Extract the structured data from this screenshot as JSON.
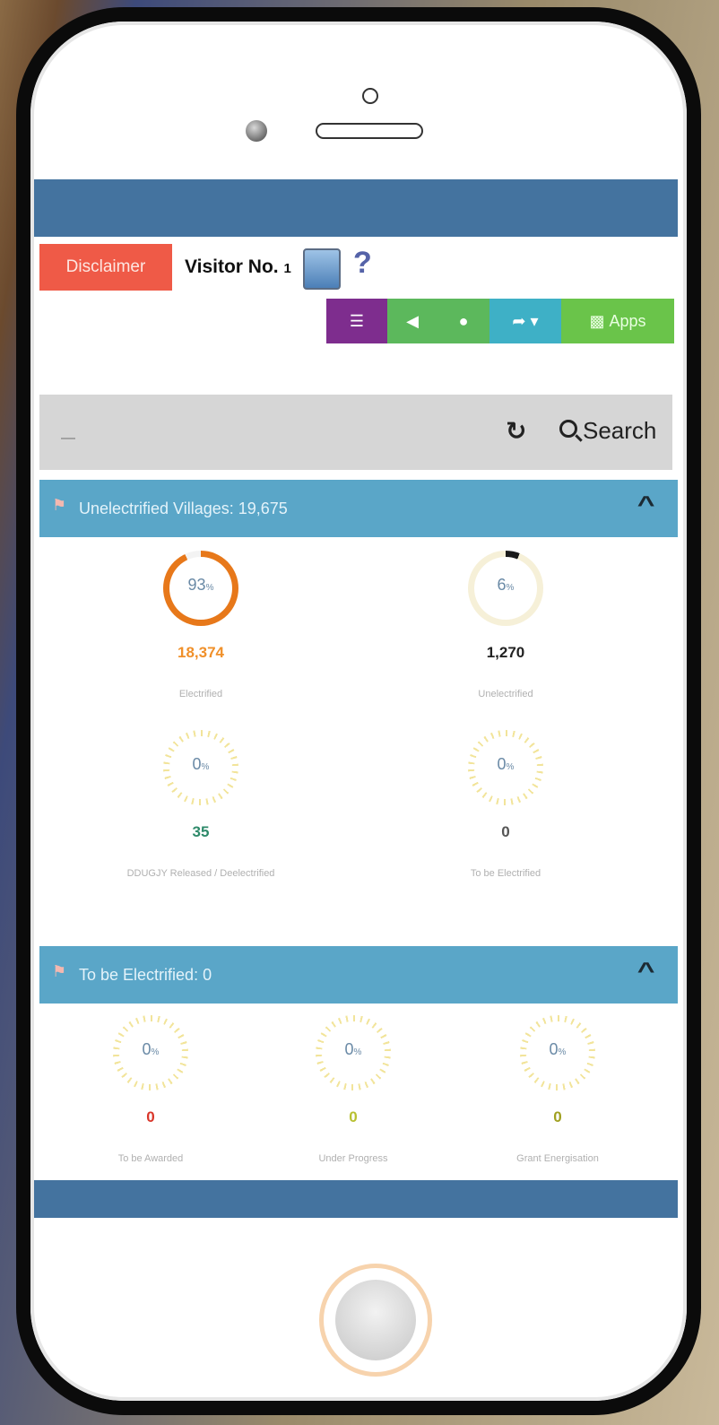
{
  "header": {
    "disclaimer_label": "Disclaimer",
    "visitor_label": "Visitor No.",
    "visitor_number": "1",
    "help_label": "?"
  },
  "toolbar": {
    "buttons": [
      {
        "icon": "list-icon",
        "label": "",
        "color": "#7e2d8e"
      },
      {
        "icon": "volume-icon",
        "label": "",
        "color": "#5cb85c"
      },
      {
        "icon": "microphone-icon",
        "label": "",
        "color": "#5cb85c"
      },
      {
        "icon": "share-icon",
        "label": "",
        "color": "#3eb0c6"
      },
      {
        "icon": "android-icon",
        "label": "Apps",
        "color": "#6ac44a"
      }
    ]
  },
  "search": {
    "placeholder": "—",
    "button_label": "Search",
    "refresh_icon": "refresh-icon"
  },
  "panel1": {
    "title": "Unelectrified Villages: 19,675",
    "stats": [
      {
        "percent": "93",
        "value": "18,374",
        "label": "Electrified",
        "value_color": "#f0902a",
        "ring_color": "#e7781a",
        "fill": 0.93
      },
      {
        "percent": "6",
        "value": "1,270",
        "label": "Unelectrified",
        "value_color": "#222222",
        "ring_color": "#1a1a1a",
        "fill": 0.06
      },
      {
        "percent": "0",
        "value": "35",
        "label": "DDUGJY Released / Deelectrified",
        "value_color": "#2e8a6a",
        "ring_color": "#e6c94a",
        "fill": 0.0
      },
      {
        "percent": "0",
        "value": "0",
        "label": "To be Electrified",
        "value_color": "#555555",
        "ring_color": "#e6c94a",
        "fill": 0.0
      }
    ]
  },
  "panel2": {
    "title": "To be Electrified: 0",
    "stats": [
      {
        "percent": "0",
        "value": "0",
        "label": "To be Awarded",
        "value_color": "#d9362a",
        "ring_color": "#e6c94a",
        "fill": 0.0
      },
      {
        "percent": "0",
        "value": "0",
        "label": "Under Progress",
        "value_color": "#b8c030",
        "ring_color": "#e6c94a",
        "fill": 0.0
      },
      {
        "percent": "0",
        "value": "0",
        "label": "Grant Energisation",
        "value_color": "#a0a020",
        "ring_color": "#e6c94a",
        "fill": 0.0
      }
    ]
  },
  "colors": {
    "brand_bar": "#44739f",
    "panel_header": "#5aa6c8",
    "disclaimer": "#ef5a47"
  }
}
